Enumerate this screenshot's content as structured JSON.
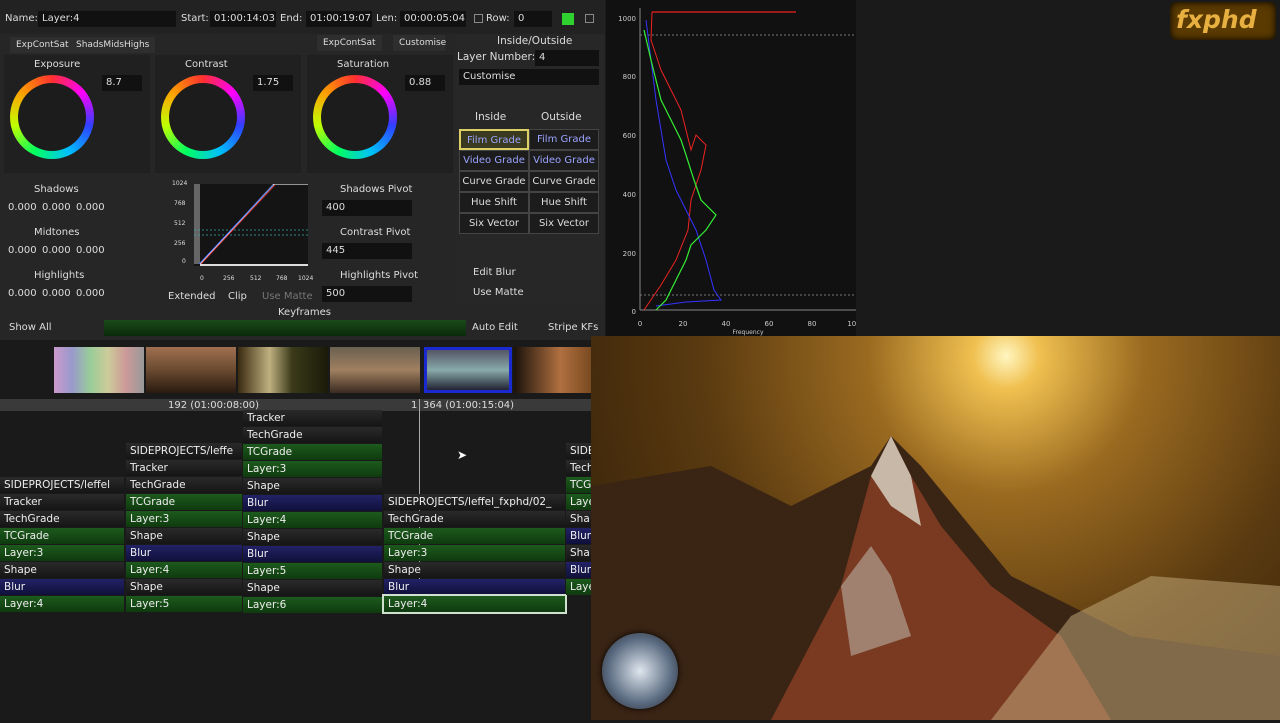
{
  "header": {
    "name_label": "Name:",
    "name_value": "Layer:4",
    "start_label": "Start:",
    "start_value": "01:00:14:03",
    "end_label": "End:",
    "end_value": "01:00:19:07",
    "len_label": "Len:",
    "len_value": "00:00:05:04",
    "row_label": "Row:",
    "row_value": "0"
  },
  "tabs": {
    "left1": "ExpContSat",
    "left2": "ShadsMidsHighs",
    "right1": "ExpContSat",
    "right2": "Customise"
  },
  "wheels": [
    {
      "name": "Exposure",
      "value": "8.7"
    },
    {
      "name": "Contrast",
      "value": "1.75"
    },
    {
      "name": "Saturation",
      "value": "0.88"
    }
  ],
  "tone": [
    {
      "name": "Shadows",
      "v1": "0.000",
      "v2": "0.000",
      "v3": "0.000"
    },
    {
      "name": "Midtones",
      "v1": "0.000",
      "v2": "0.000",
      "v3": "0.000"
    },
    {
      "name": "Highlights",
      "v1": "0.000",
      "v2": "0.000",
      "v3": "0.000"
    }
  ],
  "curve": {
    "yticks": [
      "1024",
      "768",
      "512",
      "256",
      "0"
    ],
    "xticks": [
      "0",
      "256",
      "512",
      "768",
      "1024"
    ]
  },
  "pivots": [
    {
      "name": "Shadows Pivot",
      "value": "400"
    },
    {
      "name": "Contrast Pivot",
      "value": "445"
    },
    {
      "name": "Highlights Pivot",
      "value": "500"
    }
  ],
  "checks": {
    "extended": "Extended",
    "clip": "Clip",
    "use_matte": "Use Matte"
  },
  "inside_outside": {
    "title": "Inside/Outside",
    "layer_label": "Layer Number:",
    "layer_value": "4",
    "preset": "Customise",
    "inside": "Inside",
    "outside": "Outside",
    "rows": [
      [
        "Film Grade",
        "Film Grade"
      ],
      [
        "Video Grade",
        "Video Grade"
      ],
      [
        "Curve Grade",
        "Curve Grade"
      ],
      [
        "Hue Shift",
        "Hue Shift"
      ],
      [
        "Six Vector",
        "Six Vector"
      ]
    ],
    "edit_blur": "Edit Blur",
    "use_matte": "Use Matte"
  },
  "keyframes": {
    "title": "Keyframes",
    "show_all": "Show All",
    "auto_edit": "Auto Edit",
    "stripe": "Stripe KFs"
  },
  "timeline": {
    "left_marker": "192 (01:00:08:00)",
    "mid_marker": "1",
    "right_marker": "364 (01:00:15:04)"
  },
  "stacks": [
    {
      "nodes": [
        {
          "t": "SIDEPROJECTS/leffel",
          "c": "d"
        },
        {
          "t": "Tracker",
          "c": "d"
        },
        {
          "t": "TechGrade",
          "c": "d"
        },
        {
          "t": "TCGrade",
          "c": "g"
        },
        {
          "t": "Layer:3",
          "c": "g"
        },
        {
          "t": "Shape",
          "c": "d"
        },
        {
          "t": "Blur",
          "c": "b"
        },
        {
          "t": "Layer:4",
          "c": "g"
        }
      ]
    },
    {
      "nodes": [
        {
          "t": "SIDEPROJECTS/leffe",
          "c": "d"
        },
        {
          "t": "Tracker",
          "c": "d"
        },
        {
          "t": "TechGrade",
          "c": "d"
        },
        {
          "t": "TCGrade",
          "c": "g"
        },
        {
          "t": "Layer:3",
          "c": "g"
        },
        {
          "t": "Shape",
          "c": "d"
        },
        {
          "t": "Blur",
          "c": "b"
        },
        {
          "t": "Layer:4",
          "c": "g"
        },
        {
          "t": "Shape",
          "c": "d"
        },
        {
          "t": "Layer:5",
          "c": "g"
        }
      ]
    },
    {
      "nodes": [
        {
          "t": "Tracker",
          "c": "d"
        },
        {
          "t": "TechGrade",
          "c": "d"
        },
        {
          "t": "TCGrade",
          "c": "g"
        },
        {
          "t": "Layer:3",
          "c": "g"
        },
        {
          "t": "Shape",
          "c": "d"
        },
        {
          "t": "Blur",
          "c": "b"
        },
        {
          "t": "Layer:4",
          "c": "g"
        },
        {
          "t": "Shape",
          "c": "d"
        },
        {
          "t": "Blur",
          "c": "b"
        },
        {
          "t": "Layer:5",
          "c": "g"
        },
        {
          "t": "Shape",
          "c": "d"
        },
        {
          "t": "Layer:6",
          "c": "g"
        }
      ]
    },
    {
      "nodes": [
        {
          "t": "SIDEPROJECTS/leffel_fxphd/02_",
          "c": "d"
        },
        {
          "t": "TechGrade",
          "c": "d"
        },
        {
          "t": "TCGrade",
          "c": "g"
        },
        {
          "t": "Layer:3",
          "c": "g"
        },
        {
          "t": "Shape",
          "c": "d"
        },
        {
          "t": "Blur",
          "c": "b"
        },
        {
          "t": "Layer:4",
          "c": "g"
        }
      ]
    },
    {
      "nodes": [
        {
          "t": "SIDE",
          "c": "d"
        },
        {
          "t": "Tech",
          "c": "d"
        },
        {
          "t": "TCG",
          "c": "g"
        },
        {
          "t": "Laye",
          "c": "g"
        },
        {
          "t": "Sha",
          "c": "d"
        },
        {
          "t": "Blur",
          "c": "b"
        },
        {
          "t": "Sha",
          "c": "d"
        },
        {
          "t": "Blur",
          "c": "b"
        },
        {
          "t": "Laye",
          "c": "g"
        }
      ]
    }
  ],
  "histogram": {
    "yticks": [
      "1000",
      "800",
      "600",
      "400",
      "200",
      "0"
    ],
    "xticks": [
      "0",
      "20",
      "40",
      "60",
      "80",
      "100"
    ],
    "xlabel": "Frequency"
  },
  "logo": "fxphd"
}
